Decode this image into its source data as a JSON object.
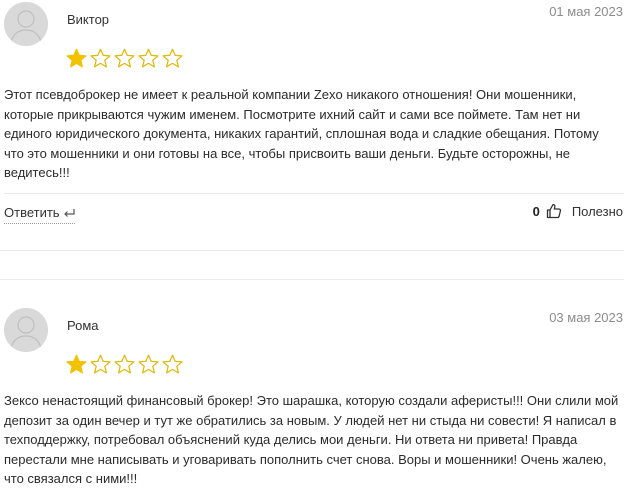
{
  "reviews": [
    {
      "author": "Виктор",
      "date": "01 мая 2023",
      "rating": 1,
      "max_rating": 5,
      "text": "Этот псевдоброкер не имеет к реальной компании Zexo никакого отношения! Они мошенники, которые прикрываются чужим именем. Посмотрите ихний сайт и сами все поймете. Там нет ни единого юридического документа, никаких гарантий, сплошная вода и сладкие обещания. Потому что это мошенники и они готовы на все, чтобы присвоить ваши деньги. Будьте осторожны, не ведитесь!!!",
      "reply_label": "Ответить",
      "useful_count": "0",
      "useful_label": "Полезно"
    },
    {
      "author": "Рома",
      "date": "03 мая 2023",
      "rating": 1,
      "max_rating": 5,
      "text": "Зексо ненастоящий финансовый брокер! Это шарашка, которую создали аферисты!!! Они слили мой депозит за один вечер и тут же обратились за новым. У людей нет ни стыда ни совести! Я написал в техподдержку, потребовал объяснений куда делись мои деньги. Ни ответа ни привета! Правда перестали мне написывать и уговаривать пополнить счет снова. Воры и мошенники! Очень жалею, что связался с ними!!!"
    }
  ],
  "colors": {
    "star_filled": "#f2c200",
    "star_outline": "#e0b800",
    "avatar_bg": "#d9d9d9",
    "date": "#8c8c8c"
  },
  "icons": {
    "avatar": "user-silhouette-icon",
    "star": "star-icon",
    "reply": "reply-arrow-icon",
    "like": "thumbs-up-icon"
  }
}
